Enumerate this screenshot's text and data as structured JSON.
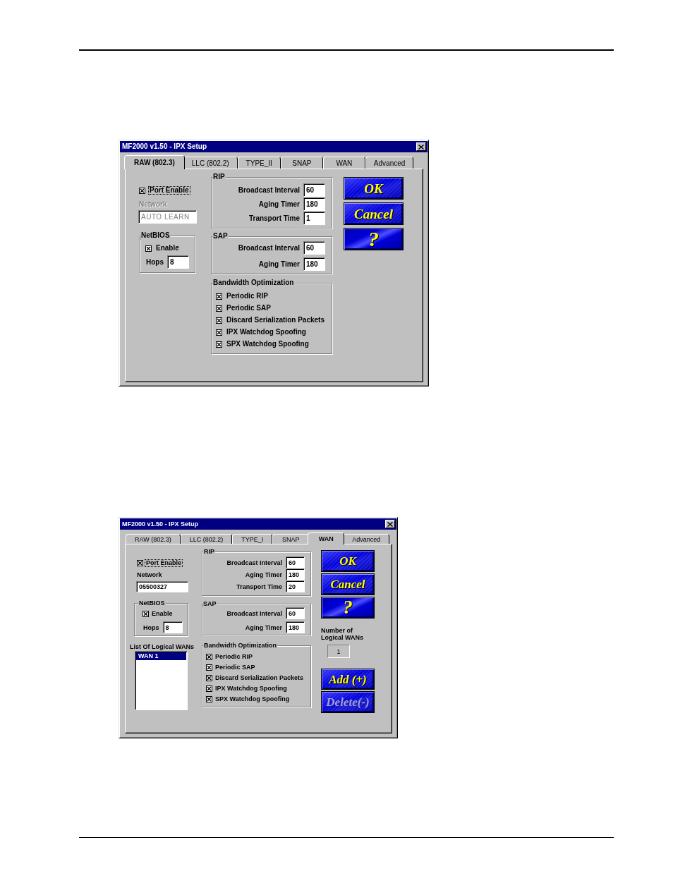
{
  "dialogs": [
    {
      "kind": "lan",
      "title": "MF2000 v1.50 - IPX Setup",
      "tabs": [
        {
          "label": "RAW (802.3)",
          "selected": true
        },
        {
          "label": "LLC (802.2)",
          "selected": false
        },
        {
          "label": "TYPE_II",
          "selected": false
        },
        {
          "label": "SNAP",
          "selected": false
        },
        {
          "label": "WAN",
          "selected": false
        },
        {
          "label": "Advanced",
          "selected": false
        }
      ],
      "port_enable": {
        "label": "Port Enable",
        "checked": true,
        "focused": true
      },
      "network": {
        "label": "Network",
        "value": "AUTO LEARN",
        "disabled": true
      },
      "netbios": {
        "title": "NetBIOS",
        "enable": {
          "label": "Enable",
          "checked": true
        },
        "hops": {
          "label": "Hops",
          "value": "8"
        }
      },
      "rip": {
        "title": "RIP",
        "fields": [
          {
            "label": "Broadcast Interval",
            "value": "60"
          },
          {
            "label": "Aging Timer",
            "value": "180"
          },
          {
            "label": "Transport Time",
            "value": "1"
          }
        ]
      },
      "sap": {
        "title": "SAP",
        "fields": [
          {
            "label": "Broadcast Interval",
            "value": "60"
          },
          {
            "label": "Aging Timer",
            "value": "180"
          }
        ]
      },
      "bandwidth": {
        "title": "Bandwidth Optimization",
        "options": [
          {
            "label": "Periodic RIP",
            "checked": true
          },
          {
            "label": "Periodic SAP",
            "checked": true
          },
          {
            "label": "Discard Serialization Packets",
            "checked": true
          },
          {
            "label": "IPX Watchdog Spoofing",
            "checked": true
          },
          {
            "label": "SPX Watchdog Spoofing",
            "checked": true
          }
        ]
      },
      "buttons": [
        {
          "label": "OK"
        },
        {
          "label": "Cancel"
        },
        {
          "label": "?"
        }
      ]
    },
    {
      "kind": "wan",
      "title": "MF2000 v1.50 - IPX Setup",
      "tabs": [
        {
          "label": "RAW (802.3)",
          "selected": false
        },
        {
          "label": "LLC (802.2)",
          "selected": false
        },
        {
          "label": "TYPE_I",
          "selected": false
        },
        {
          "label": "SNAP",
          "selected": false
        },
        {
          "label": "WAN",
          "selected": true
        },
        {
          "label": "Advanced",
          "selected": false
        }
      ],
      "port_enable": {
        "label": "Port Enable",
        "checked": true,
        "focused": true
      },
      "network": {
        "label": "Network",
        "value": "05500327",
        "disabled": false
      },
      "netbios": {
        "title": "NetBIOS",
        "enable": {
          "label": "Enable",
          "checked": true
        },
        "hops": {
          "label": "Hops",
          "value": "8"
        }
      },
      "wan_list": {
        "label": "List Of Logical WANs",
        "items": [
          {
            "label": "WAN 1",
            "selected": true
          }
        ]
      },
      "rip": {
        "title": "RIP",
        "fields": [
          {
            "label": "Broadcast Interval",
            "value": "60"
          },
          {
            "label": "Aging Timer",
            "value": "180"
          },
          {
            "label": "Transport Time",
            "value": "20"
          }
        ]
      },
      "sap": {
        "title": "SAP",
        "fields": [
          {
            "label": "Broadcast Interval",
            "value": "60"
          },
          {
            "label": "Aging Timer",
            "value": "180"
          }
        ]
      },
      "bandwidth": {
        "title": "Bandwidth Optimization",
        "options": [
          {
            "label": "Periodic RIP",
            "checked": true
          },
          {
            "label": "Periodic SAP",
            "checked": true
          },
          {
            "label": "Discard Serialization Packets",
            "checked": true
          },
          {
            "label": "IPX Watchdog Spoofing",
            "checked": true
          },
          {
            "label": "SPX Watchdog Spoofing",
            "checked": true
          }
        ]
      },
      "buttons": [
        {
          "label": "OK"
        },
        {
          "label": "Cancel"
        },
        {
          "label": "?"
        }
      ],
      "wan_count": {
        "label": "Number of Logical WANs",
        "value": "1"
      },
      "wan_buttons": [
        {
          "label": "Add (+)",
          "disabled": false
        },
        {
          "label": "Delete(-)",
          "disabled": true
        }
      ]
    }
  ]
}
